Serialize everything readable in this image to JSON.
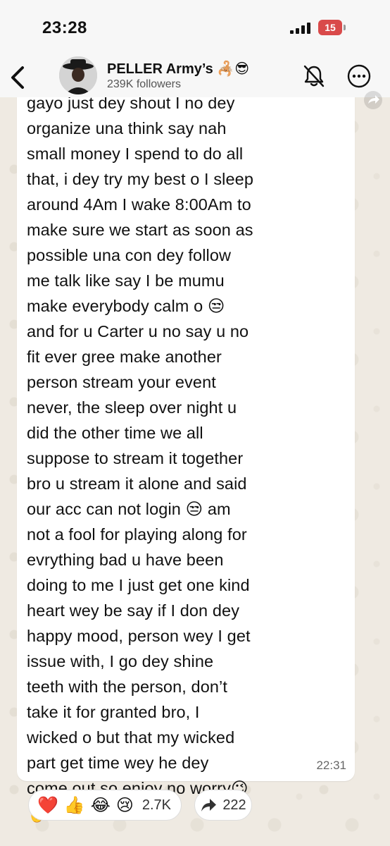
{
  "status_bar": {
    "time": "23:28",
    "battery": "15"
  },
  "header": {
    "title": "PELLER Army’s 🦂😎",
    "subtitle": "239K followers"
  },
  "message": {
    "text": "gayo just dey shout I no dey\norganize una think say nah\nsmall money I spend to do all\nthat, i dey try my best o I sleep\naround 4Am I wake 8:00Am to\nmake sure we start as soon as\npossible una con dey follow\nme talk like say I be mumu\nmake everybody calm o 😒\nand for u Carter u no say u no\nfit ever gree make another\nperson stream your event\nnever, the sleep over night u\ndid the other time we all\nsuppose to stream it together\nbro u stream it alone and said\nour acc can not login 😒 am\nnot a fool for playing along for\nevrything bad u have been\ndoing to me I just get one kind\nheart wey be say if I don dey\nhappy mood, person wey I get\nissue with, I go dey shine\nteeth with the person, don’t\ntake it for granted bro, I\nwicked o but that my wicked\npart get time wey he dey\ncome out so enjoy no worry😉\n🤞",
    "time": "22:31"
  },
  "reactions": {
    "emojis": [
      "❤️",
      "👍",
      "😂",
      "😢"
    ],
    "count": "2.7K"
  },
  "share": {
    "count": "222"
  },
  "icons": {
    "back": "chevron-left-icon",
    "mute": "bell-slash-icon",
    "more": "ellipsis-circle-icon",
    "forward": "forward-arrow-icon",
    "share": "share-arrow-icon"
  },
  "colors": {
    "wallpaper": "#efeae2",
    "bubble": "#ffffff",
    "battery": "#d94a4a"
  }
}
